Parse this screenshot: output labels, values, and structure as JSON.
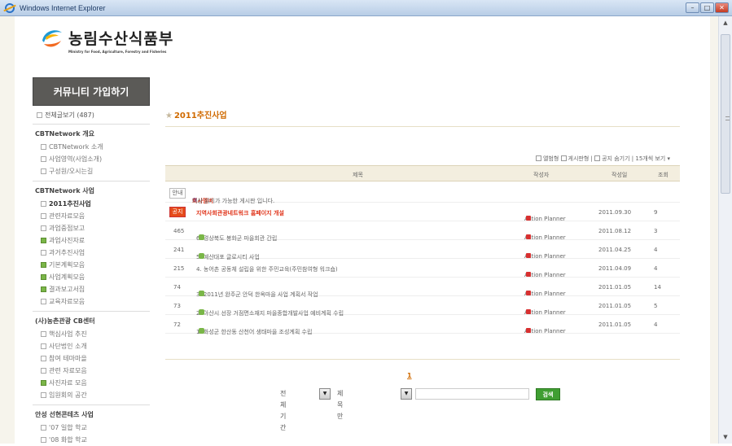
{
  "window": {
    "title": "Windows Internet Explorer"
  },
  "logo": {
    "name": "농림수산식품부",
    "subtitle": "Ministry for Food, Agriculture, Forestry and Fisheries"
  },
  "sidebar": {
    "join_label": "커뮤니티 가입하기",
    "all_posts": "전체글보기 (487)",
    "sections": [
      {
        "heading": "CBTNetwork 개요",
        "items": [
          "CBTNetwork 소개",
          "사업영역(사업소개)",
          "구성원/오시는길"
        ]
      },
      {
        "heading": "CBTNetwork 사업",
        "items": [
          "2011추진사업",
          "관련자료모음",
          "과업중점보고",
          "과업사진자료",
          "과거추진사업",
          "기본계획모음",
          "사업계획모음",
          "결과보고서집",
          "교육자료모음"
        ]
      },
      {
        "heading": "(사)농촌관광 CB센터",
        "items": [
          "핵심사업 추진",
          "사단법인 소개",
          "참여 테마마을",
          "관련 자료모음",
          "사진자료 모음",
          "임원회의 공간"
        ]
      },
      {
        "heading": "안성 선현콘테츠 사업",
        "items": [
          "'07 일합 학교",
          "'08 화합 학교"
        ]
      }
    ]
  },
  "board": {
    "title": "2011추진사업",
    "toolbar": {
      "album": "앨범형",
      "board": "게시판형",
      "hide_notice": "공지 숨기기",
      "per_page": "15개씩 보기 ▾"
    },
    "columns": {
      "subject": "제목",
      "author": "작성자",
      "date": "작성일",
      "views": "조회"
    },
    "notice": {
      "tag": "안내",
      "title_strong": "회사멤버",
      "title_rest": " 이상 읽기가 가능한 게시판 입니다."
    },
    "rows": [
      {
        "no": "공지",
        "title": "지역사회관광네트워크 홈페이지 개설",
        "author": "Action Planner",
        "date": "2011.09.30",
        "views": "9",
        "is_notice": true
      },
      {
        "no": "465",
        "title": "6. 경상북도 봉화군 마을회관 간립",
        "author": "Action Planner",
        "date": "2011.08.12",
        "views": "3",
        "is_notice": false
      },
      {
        "no": "241",
        "title": "5. 예산대포 글로시티 사업",
        "author": "Action Planner",
        "date": "2011.04.25",
        "views": "4",
        "is_notice": false
      },
      {
        "no": "215",
        "title": "4. 농어촌 공동체 설립을 위한 주민교육(주민참여형 워크숍)",
        "author": "Action Planner",
        "date": "2011.04.09",
        "views": "4",
        "is_notice": false
      },
      {
        "no": "74",
        "title": "3. 2011년 완주군 안덕 한옥마을 사업 계획서 작업",
        "author": "Action Planner",
        "date": "2011.01.05",
        "views": "14",
        "is_notice": false
      },
      {
        "no": "73",
        "title": "2. 아산시 선장 거점면소재지 마을종합개발사업 예비계획 수립",
        "author": "Action Planner",
        "date": "2011.01.05",
        "views": "5",
        "is_notice": false
      },
      {
        "no": "72",
        "title": "1. 화성군 한산동 산천어 생태마을 조성계획 수립",
        "author": "Action Planner",
        "date": "2011.01.05",
        "views": "4",
        "is_notice": false
      }
    ],
    "pager": {
      "current": "1"
    },
    "search": {
      "period": "전체기간",
      "scope": "제목만",
      "button": "검색",
      "input_value": ""
    }
  }
}
